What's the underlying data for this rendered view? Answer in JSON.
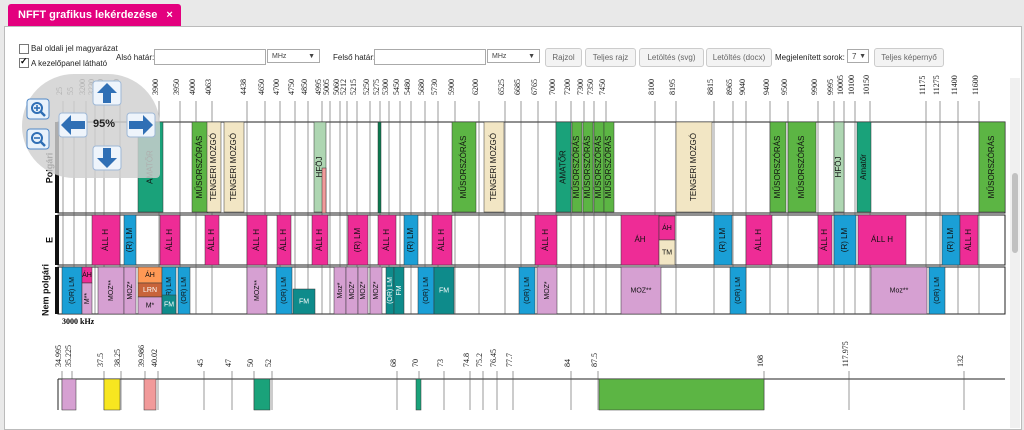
{
  "tab": {
    "title": "NFFT grafikus lekérdezése",
    "close": "×"
  },
  "controls": {
    "left_check": "Bal oldali jel magyarázat",
    "panel_check": "A kezelőpanel látható",
    "lower_label": "Alsó határ:",
    "unit": "MHz",
    "upper_label": "Felső határ:",
    "draw": "Rajzol",
    "full_draw": "Teljes rajz",
    "svg": "Letöltés (svg)",
    "docx": "Letöltés (docx)",
    "rows_label": "Megjelenített sorok:",
    "rows_value": "7",
    "fullscreen": "Teljes képernyő"
  },
  "zoom": "95%",
  "rows": {
    "polgari": "Polgári",
    "e": "E",
    "nem": "Nem polgári"
  },
  "khz_label": "3000 kHz",
  "colors": {
    "tab": "#e3007e",
    "green": "#5cb544",
    "teal": "#1aa27a",
    "darkgreen": "#0b7a4f",
    "beige": "#f2e6c4",
    "magenta": "#ee2c96",
    "cyan": "#1a9fd6",
    "lilac": "#d6a0d2",
    "orange": "#ff9955",
    "brown": "#c8643a",
    "darkteal": "#0e8b8b",
    "yellow": "#f7e620",
    "pink": "#f19a9a",
    "sage": "#aed6b2"
  },
  "ticks1": [
    "25",
    "55",
    "3200",
    "3230",
    "3400",
    "3500",
    "3900",
    "3950",
    "4000",
    "4063",
    "4438",
    "4650",
    "4700",
    "4750",
    "4850",
    "4995",
    "5005",
    "5060",
    "5212",
    "5215",
    "5250",
    "5275",
    "5300",
    "5450",
    "5480",
    "5680",
    "5730",
    "5900",
    "6200",
    "6525",
    "6685",
    "6765",
    "7000",
    "7200",
    "7300",
    "7350",
    "7450",
    "8100",
    "8195",
    "8815",
    "8965",
    "9040",
    "9400",
    "9500",
    "9900",
    "9995",
    "10005",
    "10100",
    "10150",
    "11175",
    "11275",
    "11400",
    "11600"
  ],
  "ticks2": [
    "34.995",
    "35.225",
    "37.5",
    "38.25",
    "39.986",
    "40.02",
    "45",
    "47",
    "50",
    "52",
    "68",
    "70",
    "73",
    "74.8",
    "75.2",
    "76.45",
    "77.7",
    "84",
    "87.5",
    "108",
    "117.975",
    "132"
  ],
  "polgari_labels": [
    "AMATŐR",
    "MŰSORSZÓRÁS",
    "TENGERI MOZGÓ",
    "TENGERI MOZGÓ",
    "HFÖJ",
    "MŰSORSZÓRÁS",
    "TENGERI MOZGÓ",
    "AMATŐR",
    "MŰSORSZÓRÁS",
    "MŰSORSZÓRÁS",
    "MŰSORSZÓRÁS",
    "MŰSORSZÓRÁS",
    "TENGERI MOZGÓ",
    "MŰSORSZÓRÁS",
    "MŰSORSZÓRÁS",
    "HFÖJ",
    "Amatőr",
    "MŰSORSZÓRÁS"
  ],
  "e_labels": [
    "ÁLL H",
    "(R) LM",
    "ÁLL H",
    "ÁLL H",
    "ÁLL H",
    "ÁLL H",
    "ÁLL H",
    "(R) LM",
    "ÁLL H",
    "(R) LM",
    "ÁLL H",
    "ÁLL H",
    "ÁH",
    "TM",
    "(R) LM",
    "ÁLL H",
    "ÁLL H",
    "(R) LM",
    "ÁLL H",
    "(R) LM",
    "ÁLL H"
  ],
  "nem_labels": [
    "(OR) LM",
    "ÁH",
    "M**",
    "MOZ**",
    "MOZ*",
    "ÁH",
    "LRN",
    "M*",
    "(OR) LM",
    "(OR) LM",
    "FM",
    "MOZ**",
    "(OR) LM",
    "FM",
    "Moz*",
    "MOZ*",
    "MOZ*",
    "MOZ*",
    "(OR) LM",
    "FM",
    "(OR) LM",
    "FM",
    "(OR) LM",
    "MOZ*",
    "MOZ**",
    "(OR) LM",
    "Moz**",
    "(OR) LM"
  ]
}
